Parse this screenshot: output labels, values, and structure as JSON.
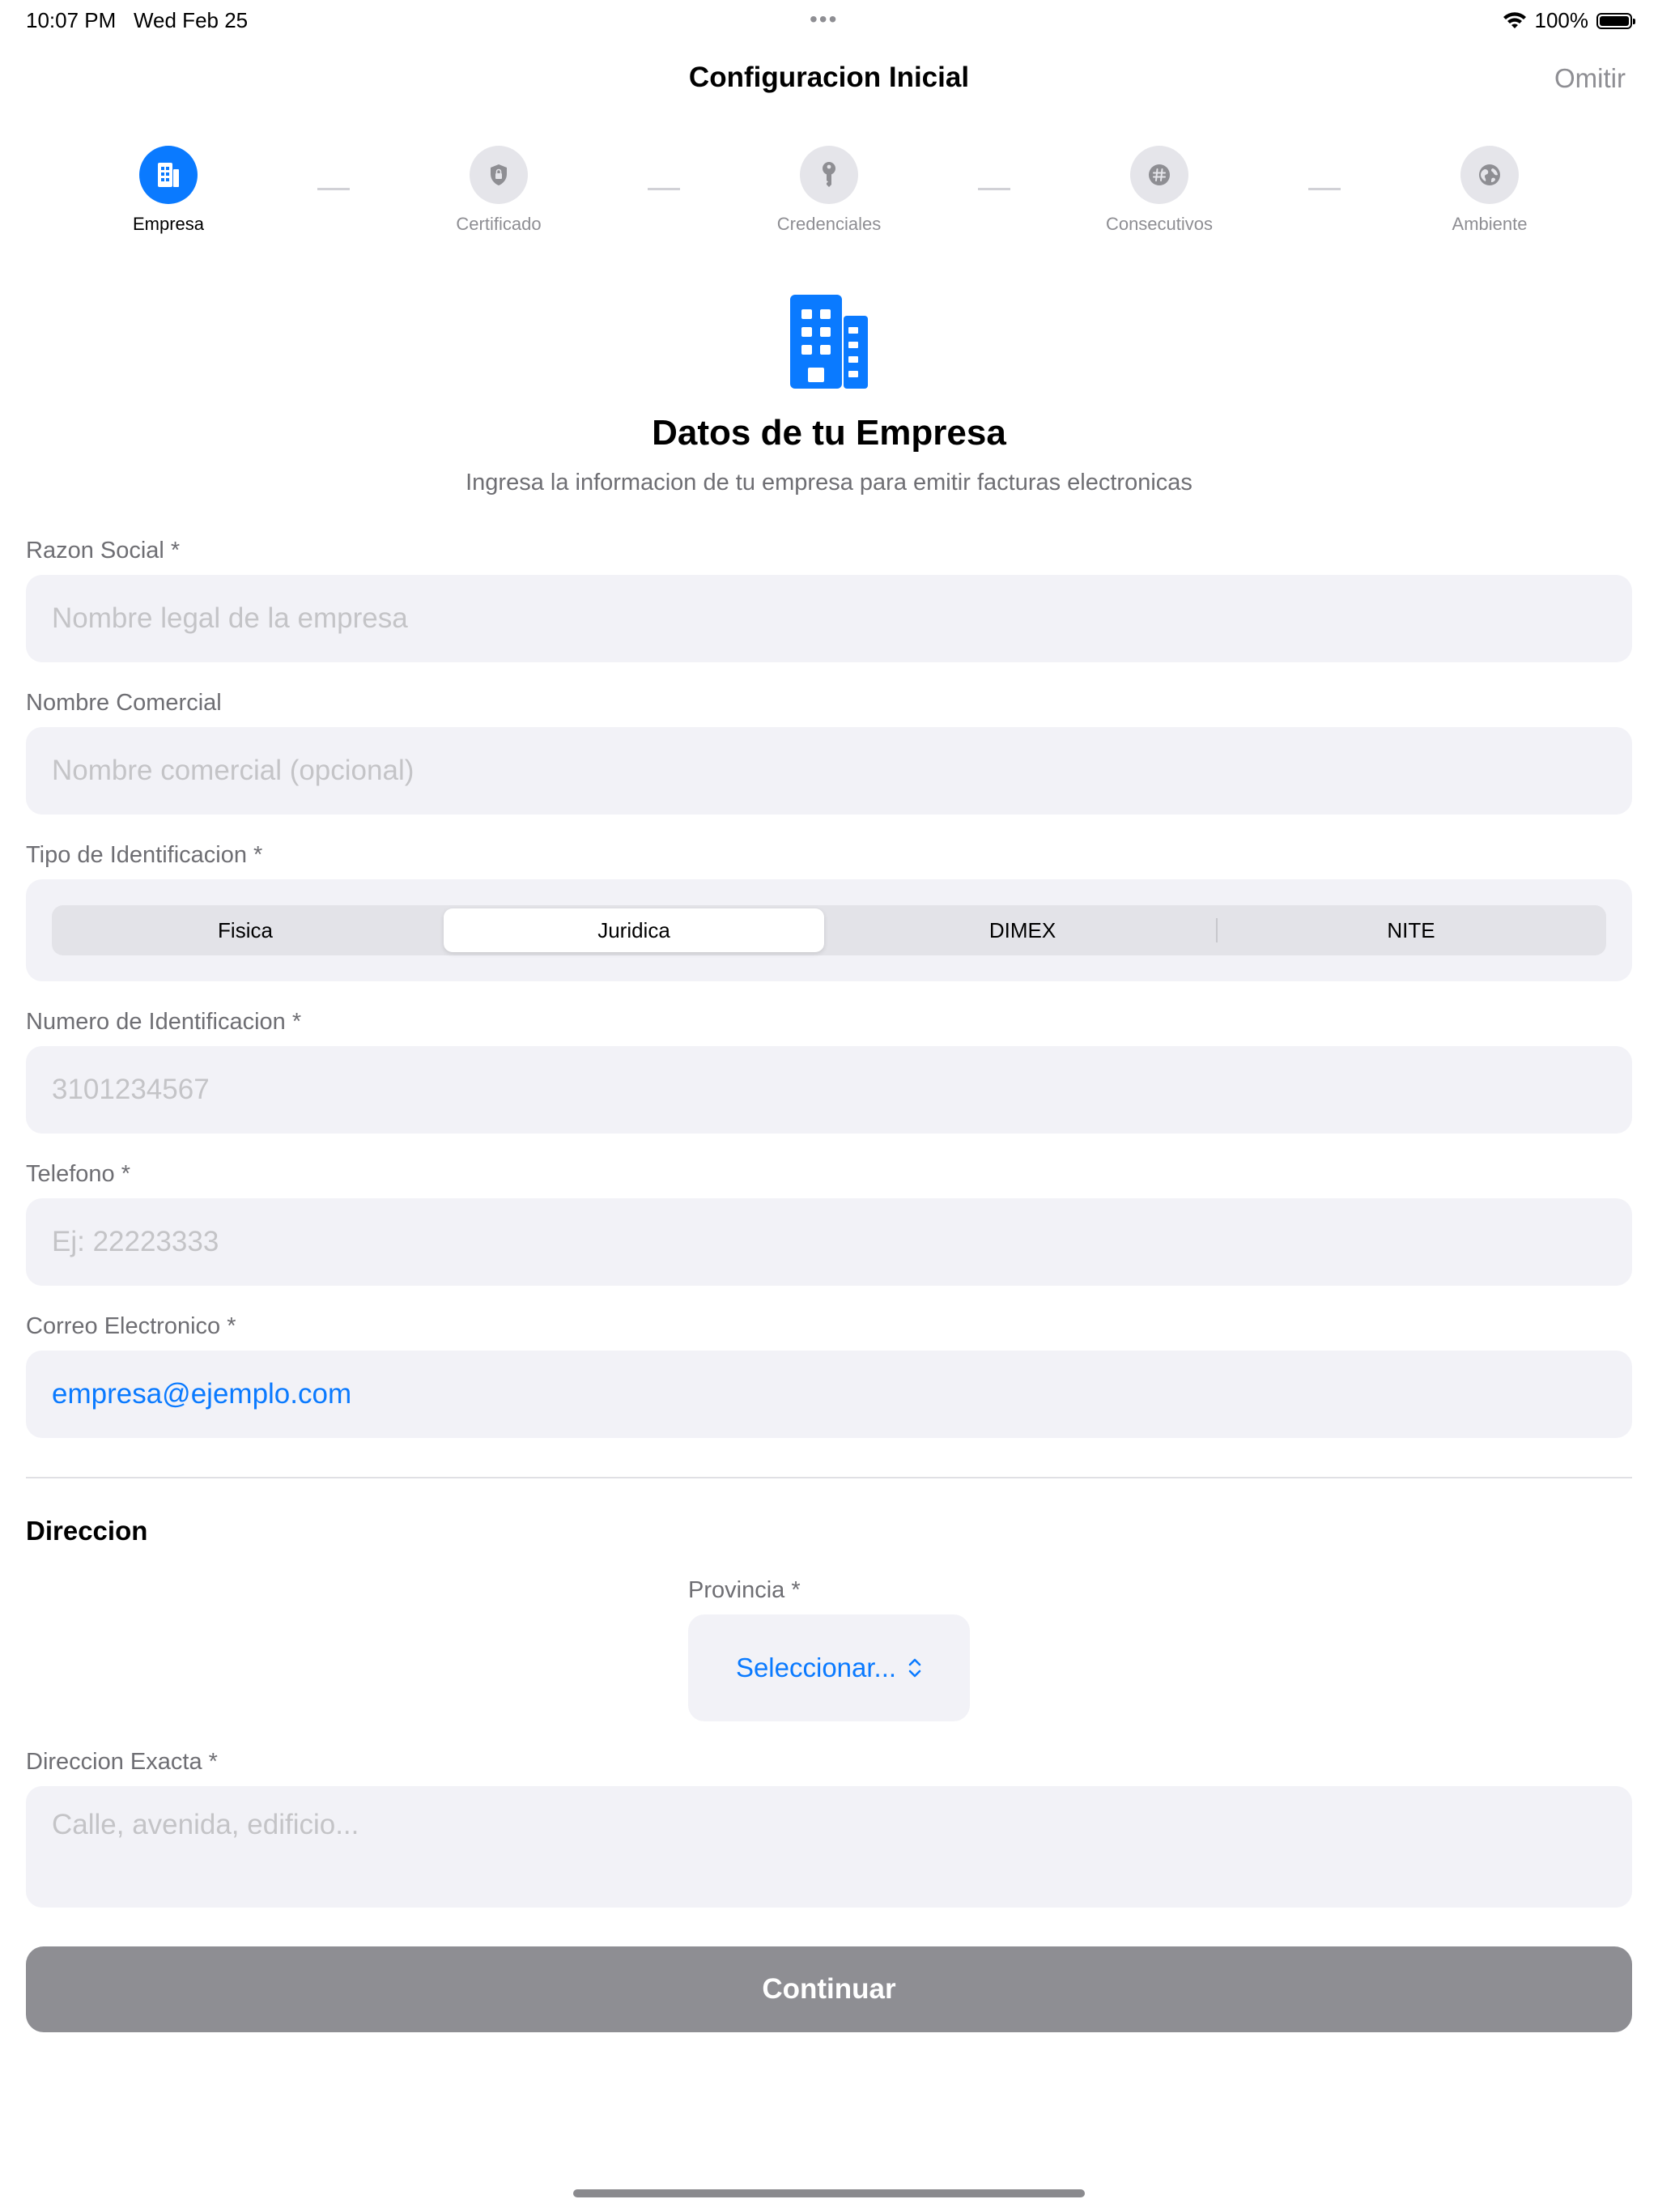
{
  "status": {
    "time": "10:07 PM",
    "date": "Wed Feb 25",
    "battery": "100%"
  },
  "nav": {
    "title": "Configuracion Inicial",
    "skip": "Omitir"
  },
  "steps": [
    {
      "label": "Empresa",
      "icon": "building-icon",
      "active": true
    },
    {
      "label": "Certificado",
      "icon": "shield-lock-icon",
      "active": false
    },
    {
      "label": "Credenciales",
      "icon": "key-icon",
      "active": false
    },
    {
      "label": "Consecutivos",
      "icon": "number-icon",
      "active": false
    },
    {
      "label": "Ambiente",
      "icon": "globe-icon",
      "active": false
    }
  ],
  "hero": {
    "icon": "building-icon",
    "title": "Datos de tu Empresa",
    "subtitle": "Ingresa la informacion de tu empresa para emitir facturas electronicas"
  },
  "form": {
    "razon_social": {
      "label": "Razon Social *",
      "placeholder": "Nombre legal de la empresa",
      "value": ""
    },
    "nombre_comercial": {
      "label": "Nombre Comercial",
      "placeholder": "Nombre comercial (opcional)",
      "value": ""
    },
    "tipo_identificacion": {
      "label": "Tipo de Identificacion *",
      "options": [
        "Fisica",
        "Juridica",
        "DIMEX",
        "NITE"
      ],
      "selected": "Juridica"
    },
    "numero_identificacion": {
      "label": "Numero de Identificacion *",
      "placeholder": "3101234567",
      "value": ""
    },
    "telefono": {
      "label": "Telefono *",
      "placeholder": "Ej: 22223333",
      "value": ""
    },
    "correo": {
      "label": "Correo Electronico *",
      "value": "empresa@ejemplo.com"
    }
  },
  "direccion": {
    "title": "Direccion",
    "provincia": {
      "label": "Provincia *",
      "value": "Seleccionar...",
      "icon": "chevron-up-down-icon"
    },
    "exacta": {
      "label": "Direccion Exacta *",
      "placeholder": "Calle, avenida, edificio..."
    }
  },
  "continue_label": "Continuar",
  "colors": {
    "accent": "#0A7AFF",
    "field_bg": "#F2F2F7",
    "button_disabled": "#8E8E93"
  }
}
